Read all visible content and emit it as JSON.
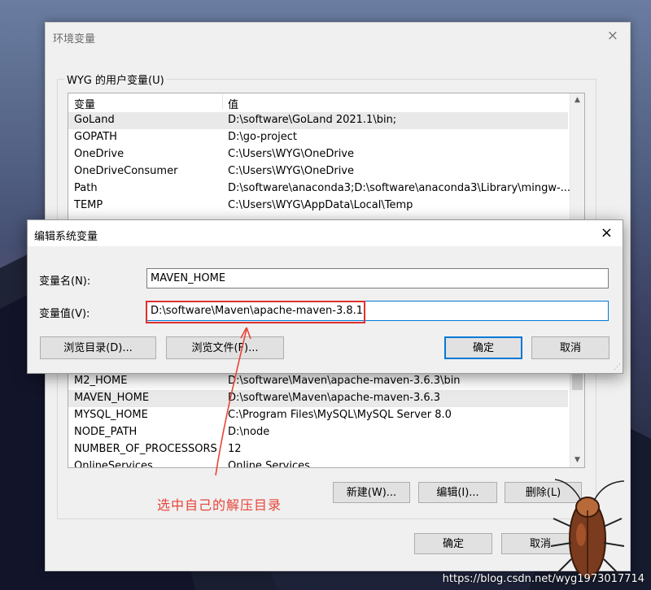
{
  "env_window": {
    "title": "环境变量",
    "user_group_label": "WYG 的用户变量(U)",
    "columns": [
      "变量",
      "值"
    ],
    "rows_top": [
      {
        "name": "GoLand",
        "value": "D:\\software\\GoLand 2021.1\\bin;",
        "selected": true
      },
      {
        "name": "GOPATH",
        "value": "D:\\go-project"
      },
      {
        "name": "OneDrive",
        "value": "C:\\Users\\WYG\\OneDrive"
      },
      {
        "name": "OneDriveConsumer",
        "value": "C:\\Users\\WYG\\OneDrive"
      },
      {
        "name": "Path",
        "value": "D:\\software\\anaconda3;D:\\software\\anaconda3\\Library\\mingw-..."
      },
      {
        "name": "TEMP",
        "value": "C:\\Users\\WYG\\AppData\\Local\\Temp"
      }
    ],
    "rows_bottom": [
      {
        "name": "M2_HOME",
        "value": "D:\\software\\Maven\\apache-maven-3.6.3\\bin"
      },
      {
        "name": "MAVEN_HOME",
        "value": "D:\\software\\Maven\\apache-maven-3.6.3",
        "selected": true
      },
      {
        "name": "MYSQL_HOME",
        "value": "C:\\Program Files\\MySQL\\MySQL Server 8.0"
      },
      {
        "name": "NODE_PATH",
        "value": "D:\\node"
      },
      {
        "name": "NUMBER_OF_PROCESSORS",
        "value": "12"
      },
      {
        "name": "OnlineServices",
        "value": "Online Services"
      }
    ],
    "buttons": {
      "new": "新建(W)...",
      "edit": "编辑(I)...",
      "delete": "删除(L)",
      "ok": "确定",
      "cancel": "取消"
    }
  },
  "edit_dialog": {
    "title": "编辑系统变量",
    "name_label": "变量名(N):",
    "name_value": "MAVEN_HOME",
    "value_label": "变量值(V):",
    "value_value": "D:\\software\\Maven\\apache-maven-3.8.1",
    "buttons": {
      "browse_dir": "浏览目录(D)...",
      "browse_file": "浏览文件(F)...",
      "ok": "确定",
      "cancel": "取消"
    }
  },
  "annotation": {
    "text": "选中自己的解压目录",
    "color": "#e8443a"
  },
  "watermark": "https://blog.csdn.net/wyg1973017714",
  "icons": {
    "close": "×",
    "scroll_up": "▲",
    "scroll_down": "▼"
  }
}
